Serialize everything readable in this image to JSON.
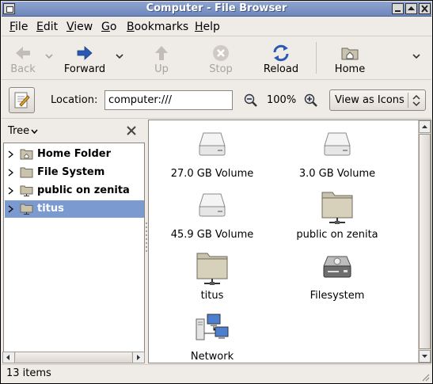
{
  "window": {
    "title": "Computer - File Browser"
  },
  "menubar": [
    "File",
    "Edit",
    "View",
    "Go",
    "Bookmarks",
    "Help"
  ],
  "toolbar": {
    "back": "Back",
    "forward": "Forward",
    "up": "Up",
    "stop": "Stop",
    "reload": "Reload",
    "home": "Home"
  },
  "location": {
    "label": "Location:",
    "value": "computer:///",
    "zoom": "100%",
    "view_mode": "View as Icons"
  },
  "sidepane": {
    "selector": "Tree",
    "items": [
      {
        "label": "Home Folder"
      },
      {
        "label": "File System"
      },
      {
        "label": "public on zenita"
      },
      {
        "label": "titus",
        "selected": true
      }
    ]
  },
  "icons": [
    {
      "label": "27.0 GB Volume",
      "icon": "drive-icon"
    },
    {
      "label": "3.0 GB Volume",
      "icon": "drive-icon"
    },
    {
      "label": "45.9 GB Volume",
      "icon": "drive-icon"
    },
    {
      "label": "public on zenita",
      "icon": "network-folder-icon"
    },
    {
      "label": "titus",
      "icon": "network-folder-icon"
    },
    {
      "label": "Filesystem",
      "icon": "harddisk-icon"
    },
    {
      "label": "Network",
      "icon": "network-icon"
    }
  ],
  "status": {
    "text": "13 items"
  },
  "colors": {
    "titlebar": "#7990c6",
    "selection": "#7b9ad0",
    "background": "#efebe7"
  }
}
